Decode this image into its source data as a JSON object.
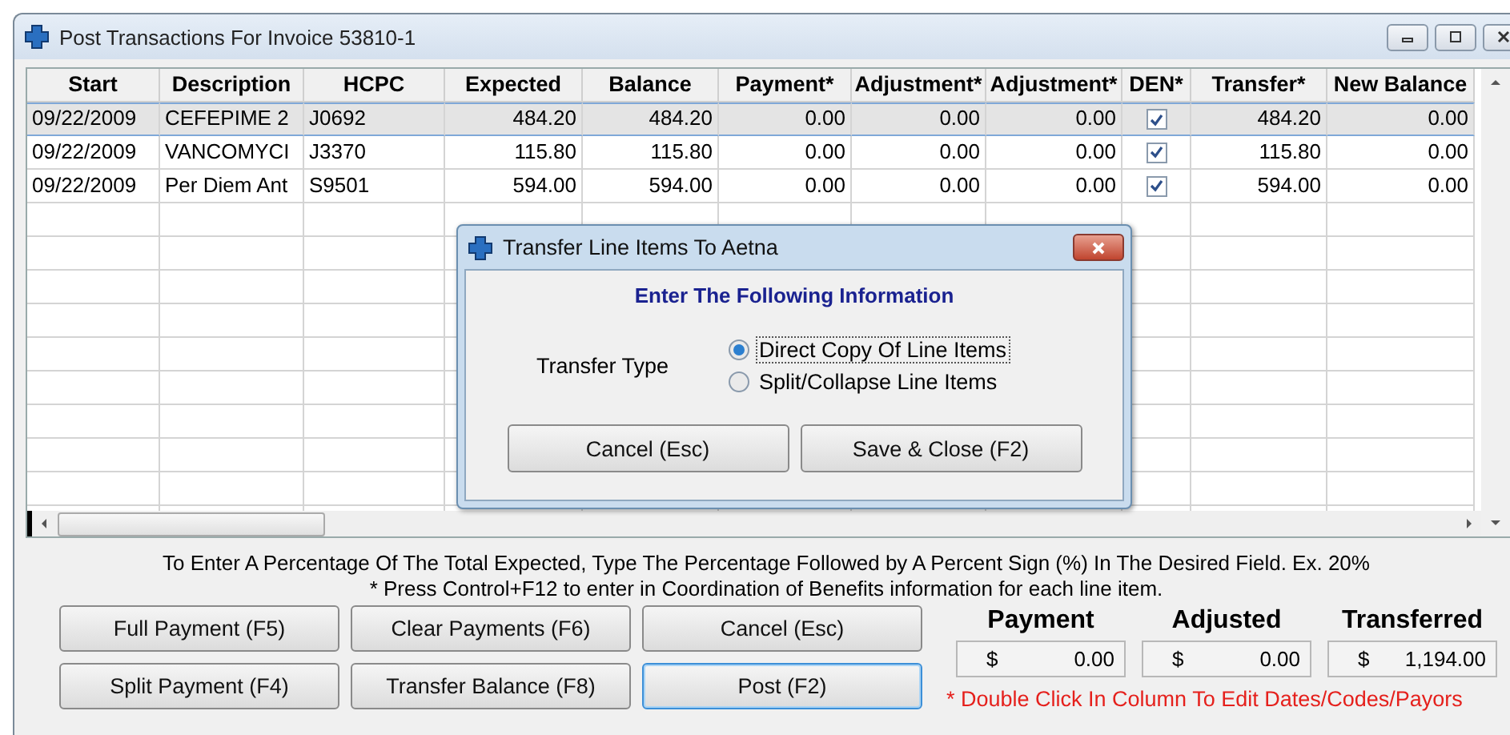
{
  "window": {
    "title": "Post Transactions For Invoice 53810-1"
  },
  "table": {
    "columns": [
      "Start",
      "Description",
      "HCPC",
      "Expected",
      "Balance",
      "Payment*",
      "Adjustment*",
      "Adjustment*",
      "DEN*",
      "Transfer*",
      "New Balance"
    ],
    "rows": [
      {
        "selected": true,
        "cells": [
          "09/22/2009",
          "CEFEPIME 2",
          "J0692",
          "484.20",
          "484.20",
          "0.00",
          "0.00",
          "0.00",
          null,
          "484.20",
          "0.00"
        ],
        "den_checked": true
      },
      {
        "selected": false,
        "cells": [
          "09/22/2009",
          "VANCOMYCI",
          "J3370",
          "115.80",
          "115.80",
          "0.00",
          "0.00",
          "0.00",
          null,
          "115.80",
          "0.00"
        ],
        "den_checked": true
      },
      {
        "selected": false,
        "cells": [
          "09/22/2009",
          "Per Diem Ant",
          "S9501",
          "594.00",
          "594.00",
          "0.00",
          "0.00",
          "0.00",
          null,
          "594.00",
          "0.00"
        ],
        "den_checked": true
      }
    ]
  },
  "dialog": {
    "title": "Transfer Line Items To Aetna",
    "heading": "Enter The Following Information",
    "field_label": "Transfer Type",
    "options": [
      {
        "label": "Direct Copy Of Line Items",
        "selected": true
      },
      {
        "label": "Split/Collapse Line Items",
        "selected": false
      }
    ],
    "buttons": [
      "Cancel (Esc)",
      "Save & Close (F2)"
    ]
  },
  "instructions": [
    "To Enter A Percentage Of The Total Expected, Type The Percentage Followed by A Percent Sign (%) In The Desired Field.  Ex. 20%",
    "* Press Control+F12 to enter in Coordination of Benefits information for each line item."
  ],
  "buttons": [
    {
      "label": "Full Payment (F5)",
      "focused": false
    },
    {
      "label": "Clear Payments (F6)",
      "focused": false
    },
    {
      "label": "Cancel (Esc)",
      "focused": false
    },
    {
      "label": "Split Payment (F4)",
      "focused": false
    },
    {
      "label": "Transfer Balance (F8)",
      "focused": false
    },
    {
      "label": "Post (F2)",
      "focused": true
    }
  ],
  "totals": [
    {
      "label": "Payment",
      "currency": "$",
      "value": "0.00"
    },
    {
      "label": "Adjusted",
      "currency": "$",
      "value": "0.00"
    },
    {
      "label": "Transferred",
      "currency": "$",
      "value": "1,194.00"
    }
  ],
  "note": "* Double Click In Column To Edit Dates/Codes/Payors"
}
